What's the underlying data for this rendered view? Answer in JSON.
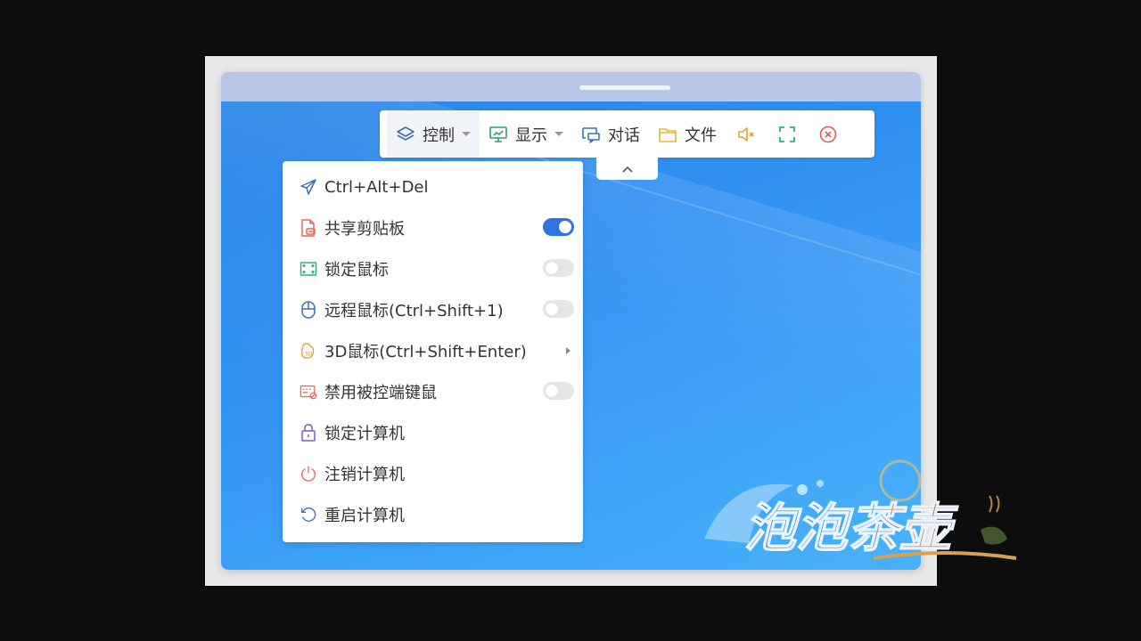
{
  "toolbar": {
    "control": {
      "label": "控制",
      "icon": "layers-icon"
    },
    "display": {
      "label": "显示",
      "icon": "monitor-icon"
    },
    "chat": {
      "label": "对话",
      "icon": "chat-icon"
    },
    "files": {
      "label": "文件",
      "icon": "folder-icon"
    },
    "mute": {
      "icon": "speaker-muted-icon"
    },
    "fullscreen": {
      "icon": "fullscreen-icon"
    },
    "close": {
      "icon": "close-circle-icon"
    }
  },
  "menu": {
    "items": [
      {
        "label": "Ctrl+Alt+Del",
        "icon": "send-icon",
        "control": "none"
      },
      {
        "label": "共享剪贴板",
        "icon": "clipboard-icon",
        "control": "toggle",
        "on": true
      },
      {
        "label": "锁定鼠标",
        "icon": "frame-icon",
        "control": "toggle",
        "on": false
      },
      {
        "label": "远程鼠标(Ctrl+Shift+1)",
        "icon": "mouse-icon",
        "control": "toggle",
        "on": false
      },
      {
        "label": "3D鼠标(Ctrl+Shift+Enter)",
        "icon": "3d-mouse-icon",
        "control": "submenu"
      },
      {
        "label": "禁用被控端键鼠",
        "icon": "keyboard-disable-icon",
        "control": "toggle",
        "on": false
      },
      {
        "label": "锁定计算机",
        "icon": "lock-icon",
        "control": "none"
      },
      {
        "label": "注销计算机",
        "icon": "power-icon",
        "control": "none"
      },
      {
        "label": "重启计算机",
        "icon": "restart-icon",
        "control": "none"
      }
    ]
  },
  "watermark": {
    "text": "泡泡茶壶"
  },
  "colors": {
    "accent": "#2f74e0",
    "desktop": "#2f8ff0",
    "titlebar": "#b7c6e6"
  }
}
